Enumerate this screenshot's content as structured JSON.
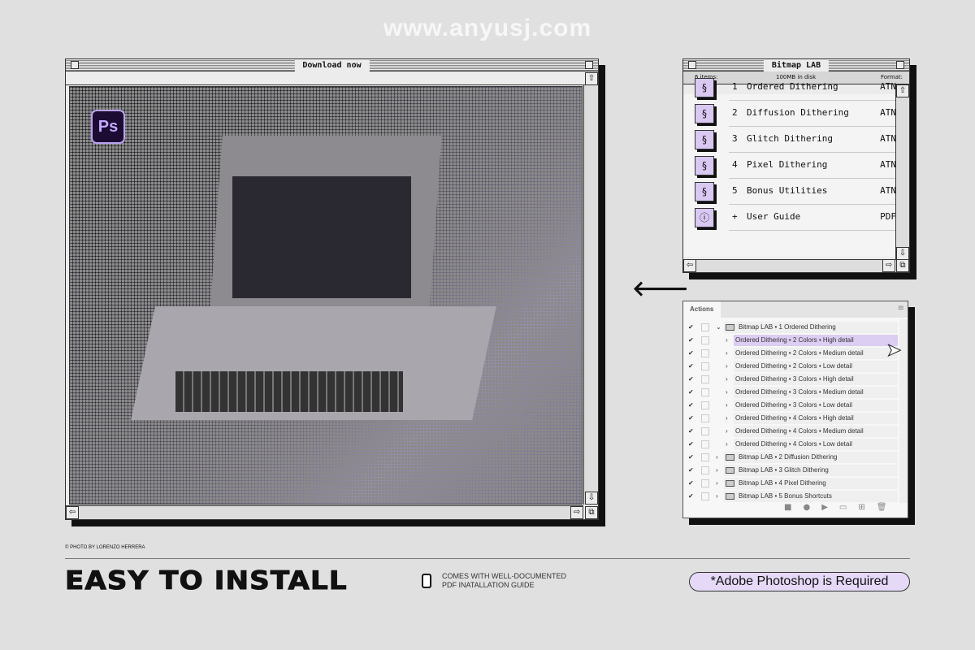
{
  "watermark": "www.anyusj.com",
  "download_window": {
    "title": "Download now",
    "app_badge": "Ps",
    "up_icon": "arrow-up-icon",
    "left_icon": "arrow-left-icon",
    "right_icon": "arrow-right-icon"
  },
  "bitmap_window": {
    "title": "Bitmap LAB",
    "info": {
      "items": "6 items:",
      "disk": "100MB in disk",
      "format": "Format:"
    },
    "items": [
      {
        "num": "1",
        "label": "Ordered Dithering",
        "format": "ATN"
      },
      {
        "num": "2",
        "label": "Diffusion Dithering",
        "format": "ATN"
      },
      {
        "num": "3",
        "label": "Glitch Dithering",
        "format": "ATN"
      },
      {
        "num": "4",
        "label": "Pixel Dithering",
        "format": "ATN"
      },
      {
        "num": "5",
        "label": "Bonus Utilities",
        "format": "ATN"
      },
      {
        "num": "+",
        "label": "User Guide",
        "format": "PDF"
      }
    ]
  },
  "actions_panel": {
    "tab": "Actions",
    "rows": [
      {
        "label": "Bitmap LAB • 1 Ordered Dithering",
        "type": "set",
        "expanded": true
      },
      {
        "label": "Ordered Dithering • 2 Colors • High detail",
        "type": "action",
        "selected": true
      },
      {
        "label": "Ordered Dithering • 2 Colors • Medium detail",
        "type": "action"
      },
      {
        "label": "Ordered Dithering • 2 Colors • Low detail",
        "type": "action"
      },
      {
        "label": "Ordered Dithering • 3 Colors • High detail",
        "type": "action"
      },
      {
        "label": "Ordered Dithering • 3 Colors • Medium detail",
        "type": "action"
      },
      {
        "label": "Ordered Dithering • 3 Colors • Low detail",
        "type": "action"
      },
      {
        "label": "Ordered Dithering • 4 Colors • High detail",
        "type": "action"
      },
      {
        "label": "Ordered Dithering • 4 Colors • Medium detail",
        "type": "action"
      },
      {
        "label": "Ordered Dithering • 4 Colors • Low detail",
        "type": "action"
      },
      {
        "label": "Bitmap LAB • 2 Diffusion Dithering",
        "type": "set"
      },
      {
        "label": "Bitmap LAB • 3 Glitch Dithering",
        "type": "set"
      },
      {
        "label": "Bitmap LAB • 4 Pixel Dithering",
        "type": "set"
      },
      {
        "label": "Bitmap LAB • 5 Bonus Shortcuts",
        "type": "set"
      }
    ],
    "toolbar": [
      "stop-icon",
      "record-icon",
      "play-icon",
      "folder-icon",
      "new-action-icon",
      "trash-icon"
    ]
  },
  "footer": {
    "credit": "© PHOTO BY LORENZO HERRERA",
    "headline": "EASY TO INSTALL",
    "guide_line1": "COMES WITH WELL-DOCUMENTED",
    "guide_line2": "PDF INATALLATION GUIDE",
    "requirement": "*Adobe Photoshop is Required"
  },
  "colors": {
    "accent": "#d9c8f2",
    "background": "#e0e0e0"
  }
}
